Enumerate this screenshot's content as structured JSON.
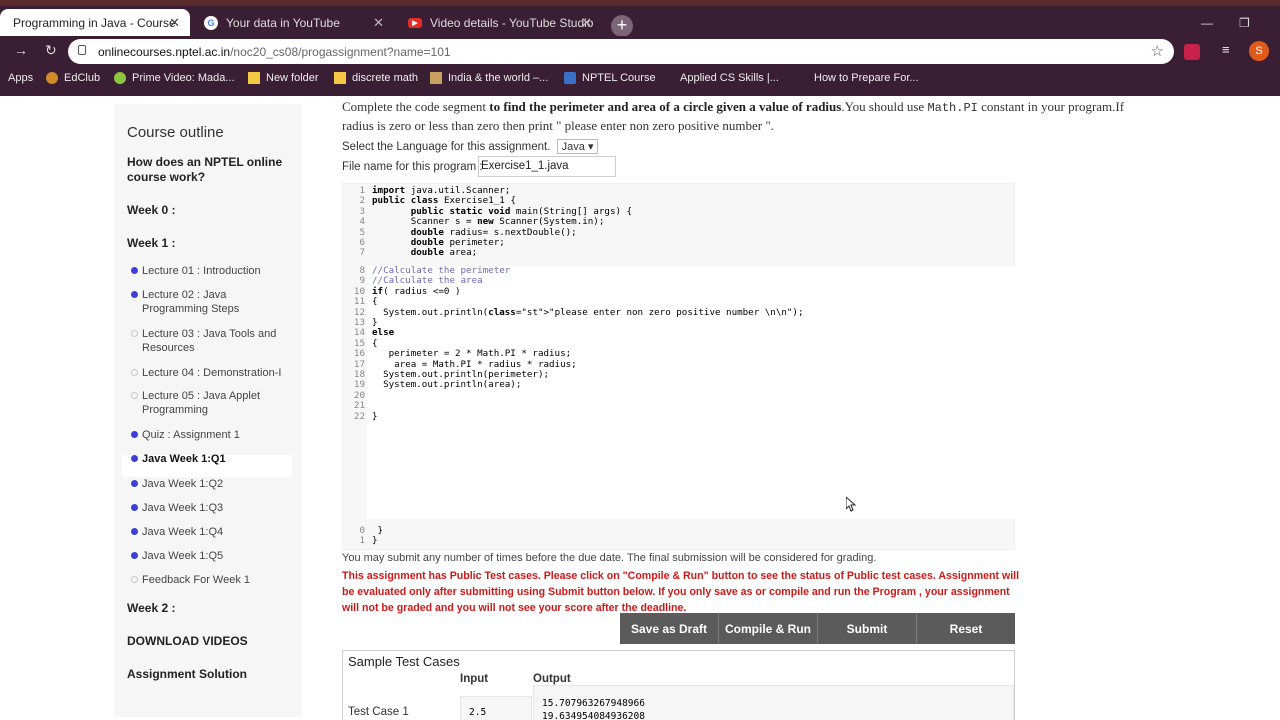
{
  "browser": {
    "tabs": [
      {
        "title": "Programming in Java - Course",
        "active": true,
        "icon": "nptel-favicon"
      },
      {
        "title": "Your data in YouTube",
        "active": false,
        "icon": "google-favicon"
      },
      {
        "title": "Video details - YouTube Studio",
        "active": false,
        "icon": "youtube-favicon"
      }
    ],
    "url_host": "onlinecourses.nptel.ac.in",
    "url_path": "/noc20_cs08/progassignment?name=101",
    "profile_initial": "S",
    "bookmarks": [
      {
        "label": "Apps",
        "icon": "apps-icon"
      },
      {
        "label": "EdClub",
        "icon": "edclub-icon"
      },
      {
        "label": "Prime Video: Mada...",
        "icon": "prime-video-icon"
      },
      {
        "label": "New folder",
        "icon": "folder-icon"
      },
      {
        "label": "discrete math",
        "icon": "folder-icon"
      },
      {
        "label": "India & the world –...",
        "icon": "news-icon"
      },
      {
        "label": "NPTEL Course",
        "icon": "nptel-icon"
      },
      {
        "label": "Applied CS Skills |...",
        "icon": "google-icon"
      },
      {
        "label": "How to Prepare For...",
        "icon": "site-icon"
      }
    ]
  },
  "sidebar": {
    "title": "Course outline",
    "sections": [
      {
        "label": "How does an NPTEL online course work?"
      },
      {
        "label": "Week 0 :"
      },
      {
        "label": "Week 1 :"
      },
      {
        "label": "Week 2 :"
      },
      {
        "label": "DOWNLOAD VIDEOS"
      },
      {
        "label": "Assignment Solution"
      }
    ],
    "items": [
      {
        "label": "Lecture 01 : Introduction",
        "status": "done"
      },
      {
        "label": "Lecture 02 : Java Programming Steps",
        "status": "done"
      },
      {
        "label": "Lecture 03 : Java Tools and Resources",
        "status": "todo"
      },
      {
        "label": "Lecture 04 : Demonstration-I",
        "status": "todo"
      },
      {
        "label": "Lecture 05 : Java Applet Programming",
        "status": "todo"
      },
      {
        "label": "Quiz : Assignment 1",
        "status": "done"
      },
      {
        "label": "Java Week 1:Q1",
        "status": "done",
        "current": true
      },
      {
        "label": "Java Week 1:Q2",
        "status": "done"
      },
      {
        "label": "Java Week 1:Q3",
        "status": "done"
      },
      {
        "label": "Java Week 1:Q4",
        "status": "done"
      },
      {
        "label": "Java Week 1:Q5",
        "status": "done"
      },
      {
        "label": "Feedback For Week 1",
        "status": "todo"
      }
    ]
  },
  "assignment": {
    "intro_a": "Complete the code segment ",
    "intro_b": "to find the perimeter and area of a circle given a value of radius",
    "intro_c": ".You should use ",
    "intro_code": "Math.PI",
    "intro_d": " constant in your program.If radius is zero or less than zero then print \" please enter non zero positive number \".",
    "language_label": "Select the Language for this assignment.",
    "language_value": "Java",
    "file_label": "File name for this program :",
    "file_value": "Exercise1_1.java",
    "submit_note": "You may submit any number of times before the due date. The final submission will be considered for grading.",
    "warning": "This assignment has Public Test cases. Please click on \"Compile & Run\" button to see the status of Public test cases. Assignment will be evaluated only after submitting using Submit button below. If you only save as or compile and run the Program , your assignment will not be graded and you will not see your score after the deadline.",
    "buttons": {
      "save": "Save as Draft",
      "compile": "Compile & Run",
      "submit": "Submit",
      "reset": "Reset"
    }
  },
  "code": {
    "header_lines": [
      [
        "1",
        "import java.util.Scanner;"
      ],
      [
        "2",
        "public class Exercise1_1 {"
      ],
      [
        "3",
        "       public static void main(String[] args) {"
      ],
      [
        "4",
        "       Scanner s = new Scanner(System.in);"
      ],
      [
        "5",
        "       double radius= s.nextDouble();"
      ],
      [
        "6",
        "       double perimeter;"
      ],
      [
        "7",
        "       double area;"
      ]
    ],
    "body_lines": [
      [
        "8",
        "//Calculate the perimeter"
      ],
      [
        "9",
        "//Calculate the area"
      ],
      [
        "10",
        "if( radius <=0 )"
      ],
      [
        "11",
        "{"
      ],
      [
        "12",
        "  System.out.println(\"please enter non zero positive number \\n\\n\");"
      ],
      [
        "13",
        "}"
      ],
      [
        "14",
        "else"
      ],
      [
        "15",
        "{"
      ],
      [
        "16",
        "   perimeter = 2 * Math.PI * radius;"
      ],
      [
        "17",
        "    area = Math.PI * radius * radius;"
      ],
      [
        "18",
        "  System.out.println(perimeter);"
      ],
      [
        "19",
        "  System.out.println(area);"
      ],
      [
        "20",
        ""
      ],
      [
        "21",
        ""
      ],
      [
        "22",
        "}"
      ]
    ],
    "footer_lines": [
      [
        "0",
        " }"
      ],
      [
        "1",
        "}"
      ]
    ]
  },
  "tests": {
    "title": "Sample Test Cases",
    "input_header": "Input",
    "output_header": "Output",
    "cases": [
      {
        "label": "Test Case 1",
        "input": "2.5",
        "output": "15.707963267948966\n19.634954084936208"
      }
    ]
  }
}
